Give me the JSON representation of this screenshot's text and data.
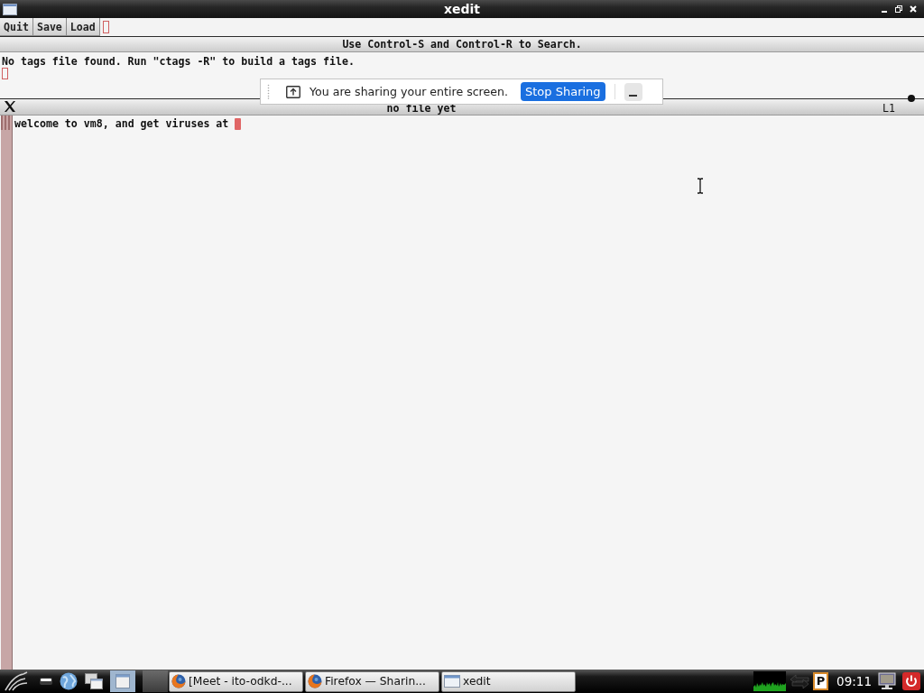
{
  "window": {
    "title": "xedit"
  },
  "menu": {
    "buttons": [
      "Quit",
      "Save",
      "Load"
    ]
  },
  "search_hint": "Use Control-S and Control-R to Search.",
  "message": "No tags file found. Run \"ctags -R\" to build a tags file.",
  "editor": {
    "file_label": "no file yet",
    "line_indicator": "L1",
    "text": "welcome to vm8, and get viruses at"
  },
  "share_bar": {
    "message": "You are sharing your entire screen.",
    "stop_button": "Stop Sharing"
  },
  "taskbar": {
    "tasks": [
      {
        "kind": "browser",
        "label": "[Meet - ito-odkd-..."
      },
      {
        "kind": "browser",
        "label": "Firefox — Sharin..."
      },
      {
        "kind": "window",
        "label": "xedit"
      }
    ],
    "indicator": "P",
    "clock": "09:11"
  }
}
